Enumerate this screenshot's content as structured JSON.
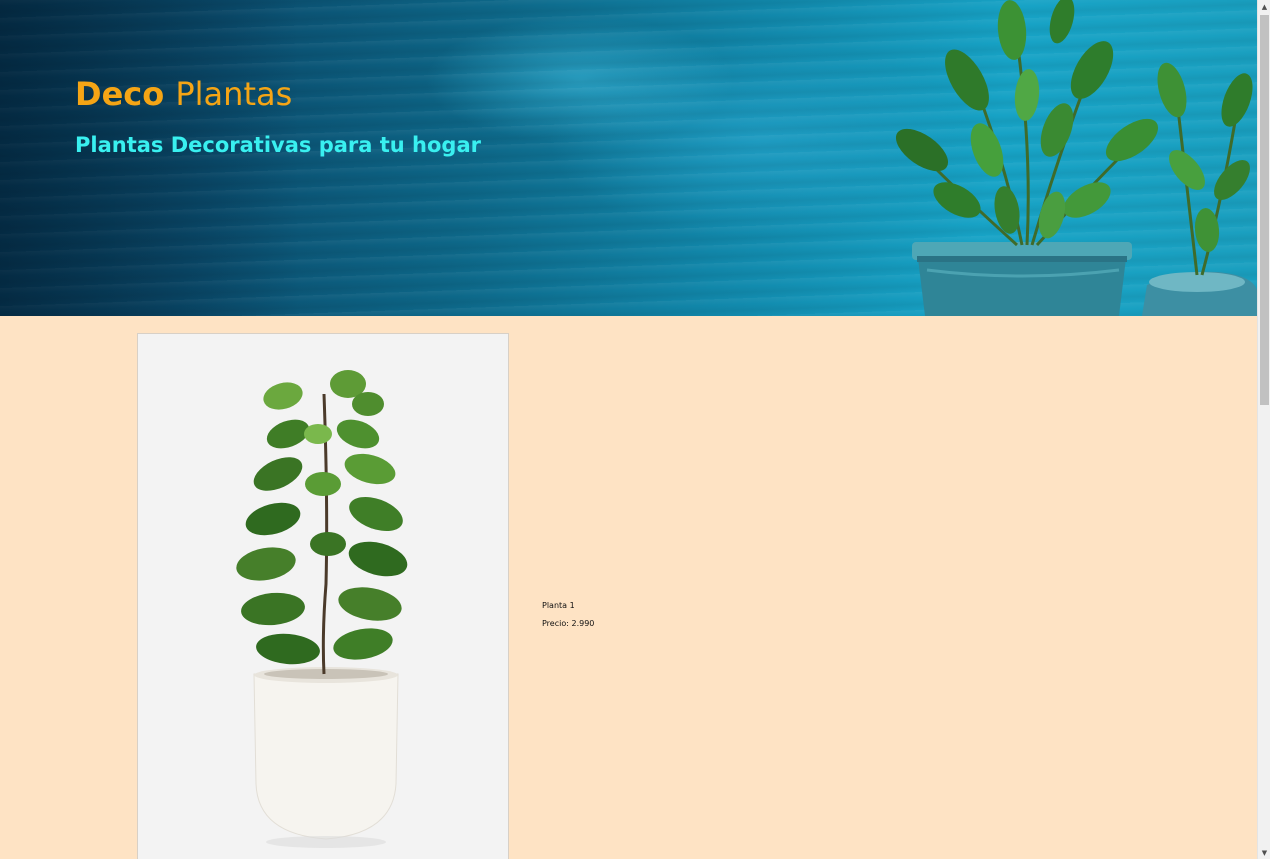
{
  "header": {
    "brand_part1": "Deco",
    "brand_part2": "Plantas",
    "tagline": "Plantas Decorativas para tu hogar"
  },
  "product": {
    "name": "Planta 1",
    "price": "Precio: 2.990",
    "image_icon": "fiddle-leaf-fig-plant-image"
  },
  "colors": {
    "brand": "#f5a515",
    "tagline": "#39f0f0",
    "page_background": "#fee3c4",
    "hero_blue": "#1187aa"
  }
}
